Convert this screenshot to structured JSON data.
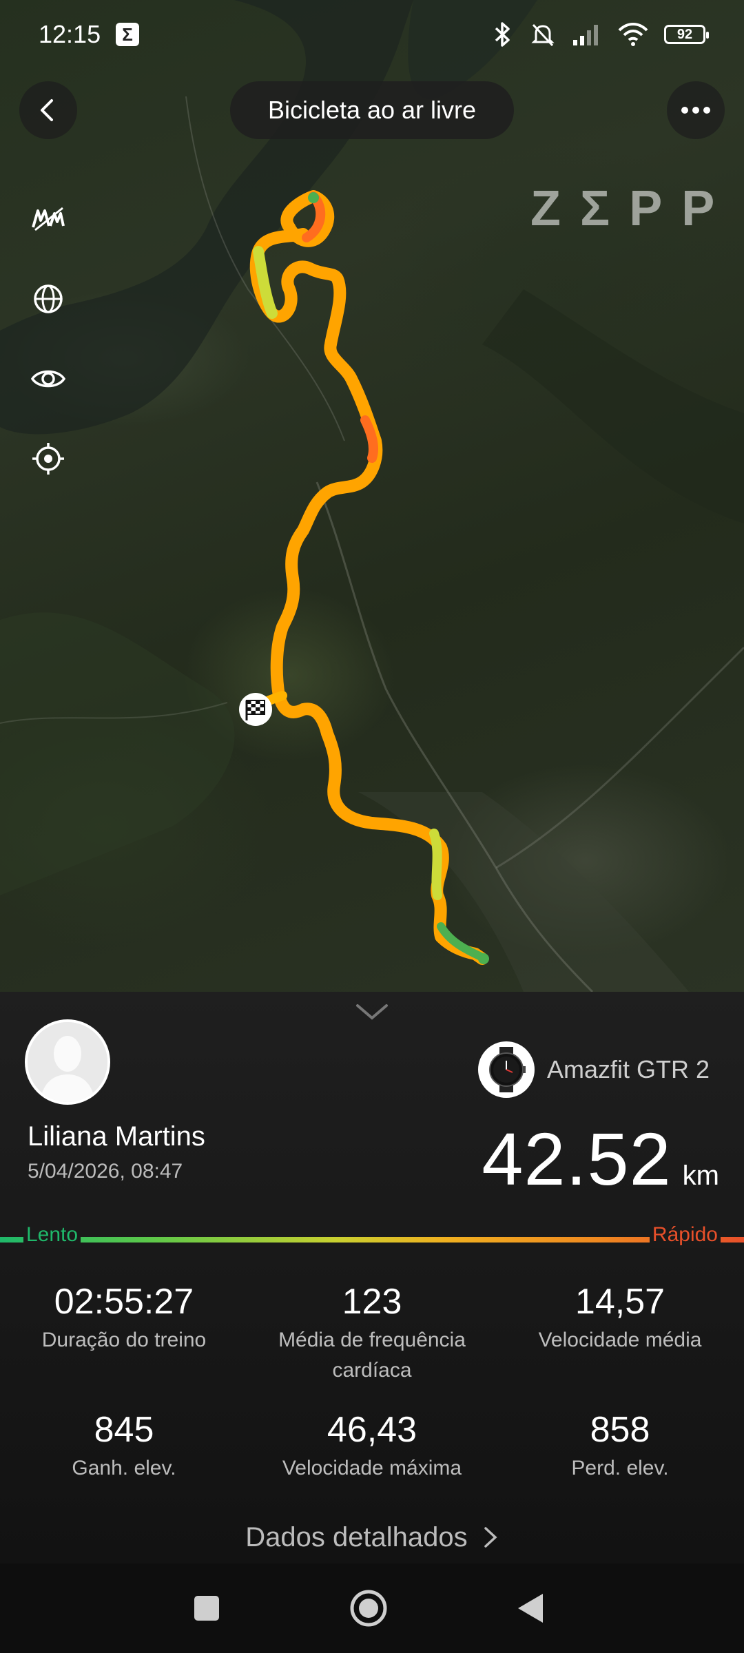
{
  "status_bar": {
    "time": "12:15",
    "notification_badge": "Σ",
    "battery_level": "92",
    "icons": [
      "bluetooth-icon",
      "mute-icon",
      "signal-icon",
      "wifi-icon",
      "battery-icon"
    ]
  },
  "header": {
    "title": "Bicicleta ao ar livre",
    "back_icon": "back-arrow-icon",
    "more_icon": "more-dots-icon"
  },
  "map": {
    "brand_logo": "ZΣPP",
    "tools": [
      "layers-km-icon",
      "globe-icon",
      "eye-icon",
      "locate-icon"
    ],
    "route_colors": [
      "#ffb300",
      "#ff9800",
      "#ff6d1f",
      "#cddc39",
      "#4caf50"
    ]
  },
  "workout": {
    "user_name": "Liliana Martins",
    "date": "5/04/2026, 08:47",
    "device": "Amazfit GTR 2",
    "distance_value": "42.52",
    "distance_unit": "km",
    "speed_scale": {
      "slow_label": "Lento",
      "fast_label": "Rápido",
      "slow_color": "#1fb86a",
      "fast_color": "#e8502a"
    },
    "stats": [
      {
        "value": "02:55:27",
        "label": "Duração do treino"
      },
      {
        "value": "123",
        "label": "Média de frequência cardíaca"
      },
      {
        "value": "14,57",
        "label": "Velocidade média"
      },
      {
        "value": "845",
        "label": "Ganh. elev."
      },
      {
        "value": "46,43",
        "label": "Velocidade máxima"
      },
      {
        "value": "858",
        "label": "Perd. elev."
      }
    ],
    "details_link": "Dados detalhados"
  },
  "nav_bar": {
    "buttons": [
      "recents-square-icon",
      "home-circle-icon",
      "back-triangle-icon"
    ]
  }
}
